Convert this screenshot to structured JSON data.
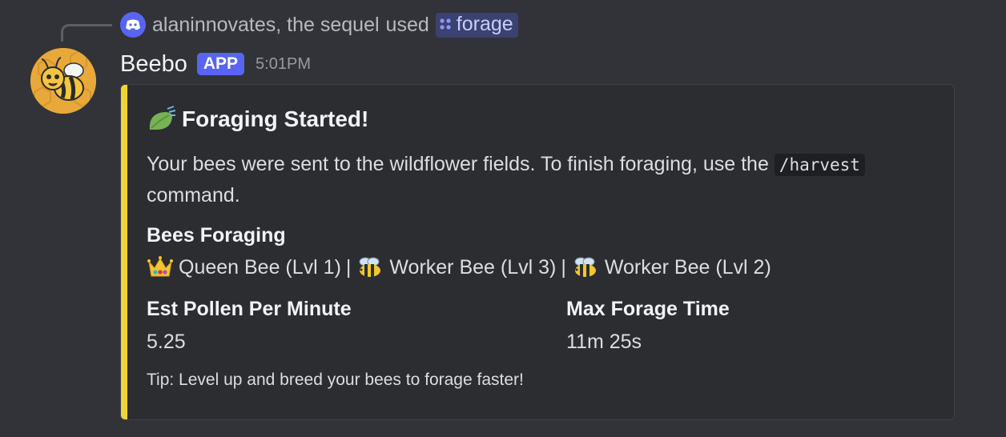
{
  "reply": {
    "user": "alaninnovates, the sequel",
    "action": "used",
    "command": "forage",
    "icon": "discord-icon"
  },
  "message": {
    "username": "Beebo",
    "badge": "APP",
    "timestamp": "5:01PM",
    "avatar": "bee-avatar"
  },
  "embed": {
    "accent_color": "#f1d431",
    "title_icon": "leaf-icon",
    "title": "Foraging Started!",
    "description_prefix": "Your bees were sent to the wildflower fields. To finish foraging, use the",
    "code": "/harvest",
    "description_suffix": "command.",
    "fields": [
      {
        "name": "Bees Foraging",
        "items": [
          {
            "icon": "crown-icon",
            "label": "Queen Bee (Lvl 1)"
          },
          {
            "icon": "bee-icon",
            "label": "Worker Bee (Lvl 3)"
          },
          {
            "icon": "bee-icon",
            "label": "Worker Bee (Lvl 2)"
          }
        ],
        "separator": "|"
      },
      {
        "name": "Est Pollen Per Minute",
        "value": "5.25"
      },
      {
        "name": "Max Forage Time",
        "value": "11m 25s"
      }
    ],
    "footer": "Tip: Level up and breed your bees to forage faster!"
  }
}
